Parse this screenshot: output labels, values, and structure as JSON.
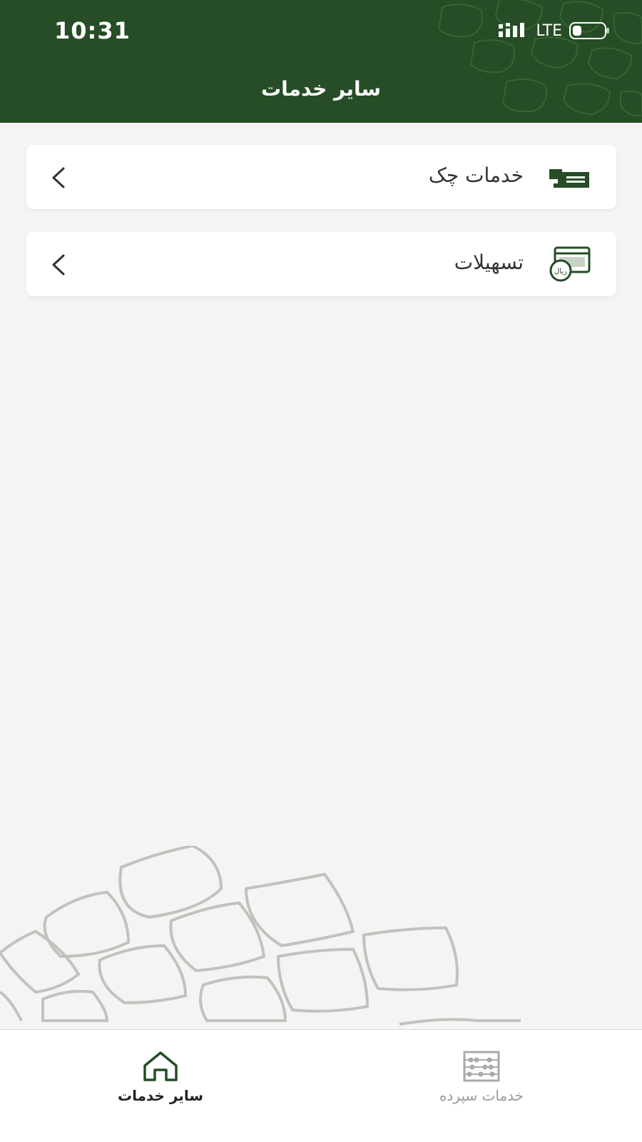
{
  "colors": {
    "header_bg": "#264d26",
    "accent": "#264d26",
    "background": "#f4f4f4",
    "inactive": "#999999"
  },
  "status_bar": {
    "time": "10:31",
    "network": "LTE",
    "signal_icon": "cellular-signal-icon",
    "battery_icon": "battery-icon"
  },
  "header": {
    "title": "سایر خدمات"
  },
  "menu": {
    "items": [
      {
        "label": "خدمات چک",
        "icon": "cheque-icon"
      },
      {
        "label": "تسهیلات",
        "icon": "loan-icon"
      }
    ]
  },
  "bottom_nav": {
    "tabs": [
      {
        "label": "سایر خدمات",
        "icon": "home-icon",
        "active": true
      },
      {
        "label": "خدمات سپرده",
        "icon": "abacus-icon",
        "active": false
      }
    ]
  }
}
